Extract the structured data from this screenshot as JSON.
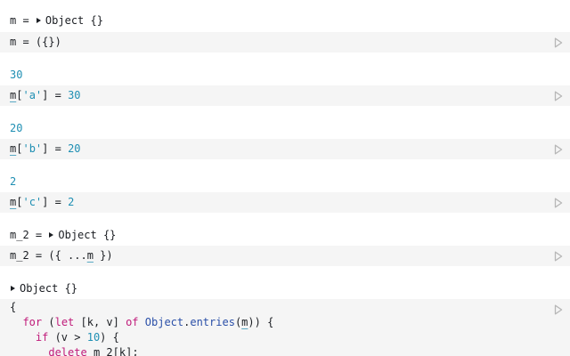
{
  "cells": [
    {
      "output": {
        "name": "m",
        "eq": " = ",
        "value": "Object {}"
      },
      "code": {
        "a": "m",
        "b": " = ({})"
      }
    },
    {
      "output": {
        "value": "30"
      },
      "code": {
        "ref": "m",
        "open": "[",
        "key": "'a'",
        "close": "] = ",
        "val": "30"
      }
    },
    {
      "output": {
        "value": "20"
      },
      "code": {
        "ref": "m",
        "open": "[",
        "key": "'b'",
        "close": "] = ",
        "val": "20"
      }
    },
    {
      "output": {
        "value": "2"
      },
      "code": {
        "ref": "m",
        "open": "[",
        "key": "'c'",
        "close": "] = ",
        "val": "2"
      }
    },
    {
      "output": {
        "name": "m_2",
        "eq": " = ",
        "value": "Object {}"
      },
      "code": {
        "a": "m_2",
        "b": " = ({ ...",
        "ref": "m",
        "c": " })"
      }
    },
    {
      "output": {
        "value": "Object {}"
      },
      "code": {
        "l1": "{",
        "l2": {
          "indent": "  ",
          "for": "for",
          "p1": " (",
          "let": "let",
          "p2": " [k, v] ",
          "of": "of",
          "sp": " ",
          "obj": "Object",
          "dot": ".",
          "entries": "entries",
          "p3": "(",
          "ref": "m",
          "p4": ")) {"
        },
        "l3": {
          "indent": "    ",
          "if": "if",
          "p1": " (v > ",
          "num": "10",
          "p2": ") {"
        },
        "l4": {
          "indent": "      ",
          "del": "delete",
          "sp": " ",
          "ref": "m_2",
          "rest": "[k];"
        }
      }
    }
  ],
  "icons": {
    "run": "play-outline-icon",
    "expand": "disclosure-triangle-icon"
  }
}
